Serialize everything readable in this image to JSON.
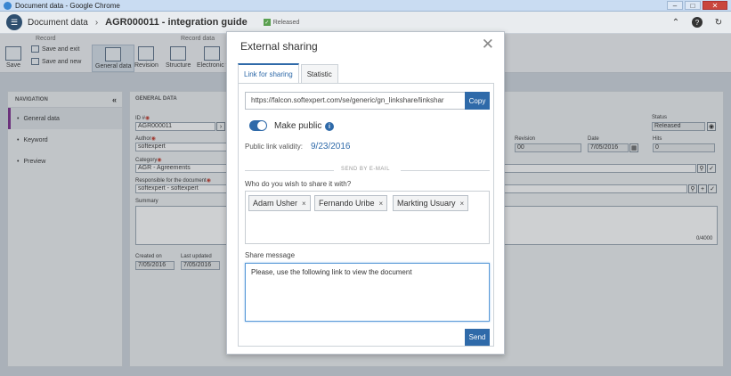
{
  "window": {
    "title": "Document data - Google Chrome"
  },
  "header": {
    "section": "Document data",
    "doc_title": "AGR000011 - integration guide",
    "status": "Released"
  },
  "toolbar": {
    "record_group": "Record",
    "record_data_group": "Record data",
    "save": "Save",
    "save_and_exit": "Save and exit",
    "save_and_new": "Save and new",
    "general_data": "General data",
    "revision": "Revision",
    "structure": "Structure",
    "electronic": "Electronic f"
  },
  "nav": {
    "title": "NAVIGATION",
    "items": [
      {
        "label": "General data"
      },
      {
        "label": "Keyword"
      },
      {
        "label": "Preview"
      }
    ]
  },
  "form": {
    "heading": "GENERAL DATA",
    "id_label": "ID #",
    "id_value": "AGR000011",
    "author_label": "Author",
    "author_value": "softexpert",
    "category_label": "Category",
    "category_value": "AGR - Agreements",
    "responsible_label": "Responsible for the document",
    "responsible_value": "softexpert - softexpert",
    "summary_label": "Summary",
    "summary_counter": "0/4000",
    "created_label": "Created on",
    "created_value": "7/05/2016",
    "updated_label": "Last updated",
    "updated_value": "7/05/2016",
    "status_label": "Status",
    "status_value": "Released",
    "revision_label": "Revision",
    "revision_value": "00",
    "date_label": "Date",
    "date_value": "7/05/2016",
    "hits_label": "Hits",
    "hits_value": "0"
  },
  "modal": {
    "title": "External sharing",
    "tabs": [
      "Link for sharing",
      "Statistic"
    ],
    "link_value": "https://falcon.softexpert.com/se/generic/gn_linkshare/linkshar",
    "copy_label": "Copy",
    "make_public_label": "Make public",
    "make_public_on": true,
    "validity_label": "Public link validity:",
    "validity_value": "9/23/2016",
    "email_section": "SEND BY E-MAIL",
    "share_with_label": "Who do you wish to share it with?",
    "recipients": [
      "Adam Usher",
      "Fernando Uribe",
      "Markting Usuary"
    ],
    "message_label": "Share message",
    "message_value": "Please, use the following link to view the document",
    "send_label": "Send"
  }
}
